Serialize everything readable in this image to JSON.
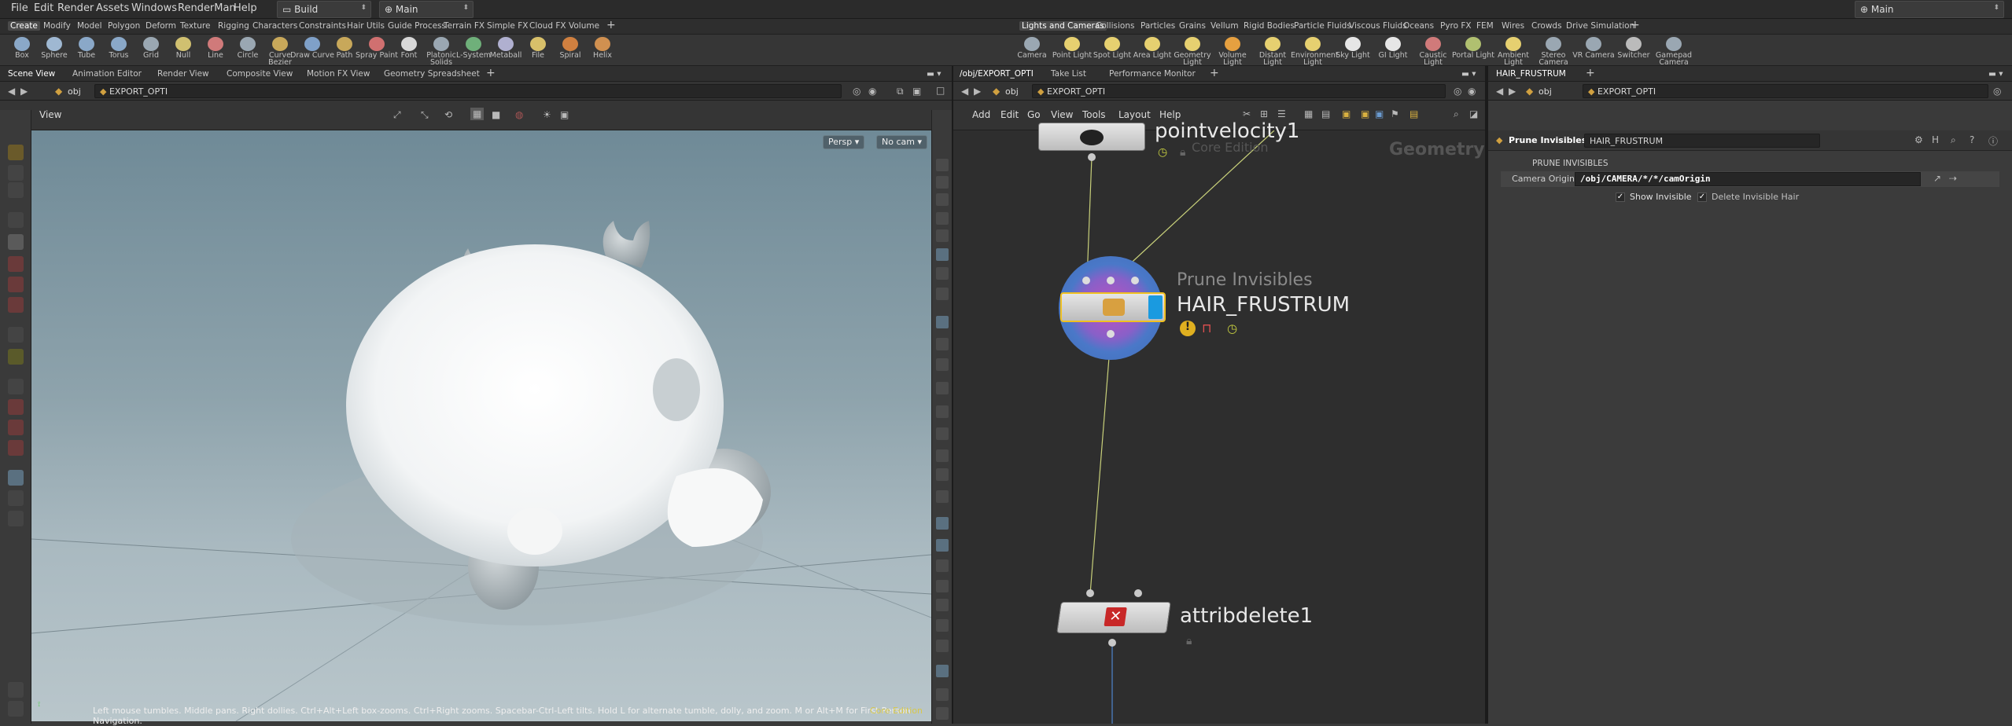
{
  "menubar": {
    "items": [
      "File",
      "Edit",
      "Render",
      "Assets",
      "Windows",
      "RenderMan",
      "Help"
    ],
    "desktop": "Build",
    "context": "Main",
    "right_desktop": "Main"
  },
  "shelf_tabs_left": [
    "Create",
    "Modify",
    "Model",
    "Polygon",
    "Deform",
    "Texture",
    "Rigging",
    "Characters",
    "Constraints",
    "Hair Utils",
    "Guide Process",
    "Terrain FX",
    "Simple FX",
    "Cloud FX",
    "Volume"
  ],
  "shelf_tabs_right": [
    "Lights and Cameras",
    "Collisions",
    "Particles",
    "Grains",
    "Vellum",
    "Rigid Bodies",
    "Particle Fluids",
    "Viscous Fluids",
    "Oceans",
    "Pyro FX",
    "FEM",
    "Wires",
    "Crowds",
    "Drive Simulation"
  ],
  "shelf_tools_left": [
    {
      "label": "Box",
      "color": "#8aa8c8"
    },
    {
      "label": "Sphere",
      "color": "#9fb8d2"
    },
    {
      "label": "Tube",
      "color": "#8aa8c8"
    },
    {
      "label": "Torus",
      "color": "#8aa8c8"
    },
    {
      "label": "Grid",
      "color": "#9aa7b2"
    },
    {
      "label": "Null",
      "color": "#d0c070"
    },
    {
      "label": "Line",
      "color": "#d07a7a"
    },
    {
      "label": "Circle",
      "color": "#9aa7b2"
    },
    {
      "label": "Curve Bezier",
      "color": "#c8a85a"
    },
    {
      "label": "Draw Curve",
      "color": "#7fa0c8"
    },
    {
      "label": "Path",
      "color": "#c8a85a"
    },
    {
      "label": "Spray Paint",
      "color": "#d07070"
    },
    {
      "label": "Font",
      "color": "#d8d8d8"
    },
    {
      "label": "Platonic Solids",
      "color": "#9aa7b2"
    },
    {
      "label": "L-System",
      "color": "#6fb07a"
    },
    {
      "label": "Metaball",
      "color": "#b0b0d0"
    },
    {
      "label": "File",
      "color": "#d8c06a"
    },
    {
      "label": "Spiral",
      "color": "#d08040"
    },
    {
      "label": "Helix",
      "color": "#d09050"
    }
  ],
  "shelf_tools_right": [
    {
      "label": "Camera",
      "color": "#9aa7b2"
    },
    {
      "label": "Point Light",
      "color": "#e6d070"
    },
    {
      "label": "Spot Light",
      "color": "#e6d070"
    },
    {
      "label": "Area Light",
      "color": "#e6d070"
    },
    {
      "label": "Geometry Light",
      "color": "#e6d070"
    },
    {
      "label": "Volume Light",
      "color": "#e6a040"
    },
    {
      "label": "Distant Light",
      "color": "#e6d070"
    },
    {
      "label": "Environment Light",
      "color": "#e6d070"
    },
    {
      "label": "Sky Light",
      "color": "#e6e6e6"
    },
    {
      "label": "GI Light",
      "color": "#e6e6e6"
    },
    {
      "label": "Caustic Light",
      "color": "#d07a7a"
    },
    {
      "label": "Portal Light",
      "color": "#b0c070"
    },
    {
      "label": "Ambient Light",
      "color": "#e6d070"
    },
    {
      "label": "Stereo Camera",
      "color": "#9aa7b2"
    },
    {
      "label": "VR Camera",
      "color": "#9aa7b2"
    },
    {
      "label": "Switcher",
      "color": "#bbbbbb"
    },
    {
      "label": "Gamepad Camera",
      "color": "#9aa7b2"
    }
  ],
  "left_pane": {
    "tabs": [
      "Scene View",
      "Animation Editor",
      "Render View",
      "Composite View",
      "Motion FX View",
      "Geometry Spreadsheet"
    ],
    "path_root": "obj",
    "path_node": "EXPORT_OPTI",
    "view_label": "View",
    "persp": "Persp",
    "cam": "No cam",
    "status_text": "Left mouse tumbles. Middle pans. Right dollies. Ctrl+Alt+Left box-zooms. Ctrl+Right zooms. Spacebar-Ctrl-Left tilts. Hold L for alternate tumble, dolly, and zoom.     M or Alt+M for First Person Navigation.",
    "edition": "Core Edition"
  },
  "mid_pane": {
    "tabs": [
      "/obj/EXPORT_OPTI",
      "Take List",
      "Performance Monitor"
    ],
    "path_root": "obj",
    "path_node": "EXPORT_OPTI",
    "menu": [
      "Add",
      "Edit",
      "Go",
      "View",
      "Tools",
      "Layout",
      "Help"
    ],
    "context_label": "Geometry",
    "nodes": {
      "top": {
        "name": "pointvelocity1",
        "sub": "Core Edition"
      },
      "mid": {
        "type": "Prune Invisibles",
        "name": "HAIR_FRUSTRUM"
      },
      "bottom": {
        "name": "attribdelete1"
      }
    }
  },
  "right_pane": {
    "tab": "HAIR_FRUSTRUM",
    "path_root": "obj",
    "path_node": "EXPORT_OPTI",
    "node_type": "Prune Invisibles",
    "node_name": "HAIR_FRUSTRUM",
    "section": "PRUNE INVISIBLES",
    "camera_origin_label": "Camera Origin",
    "camera_origin_value": "/obj/CAMERA/*/*/camOrigin",
    "show_invisible": "Show Invisible",
    "delete_invisible": "Delete Invisible Hair"
  }
}
